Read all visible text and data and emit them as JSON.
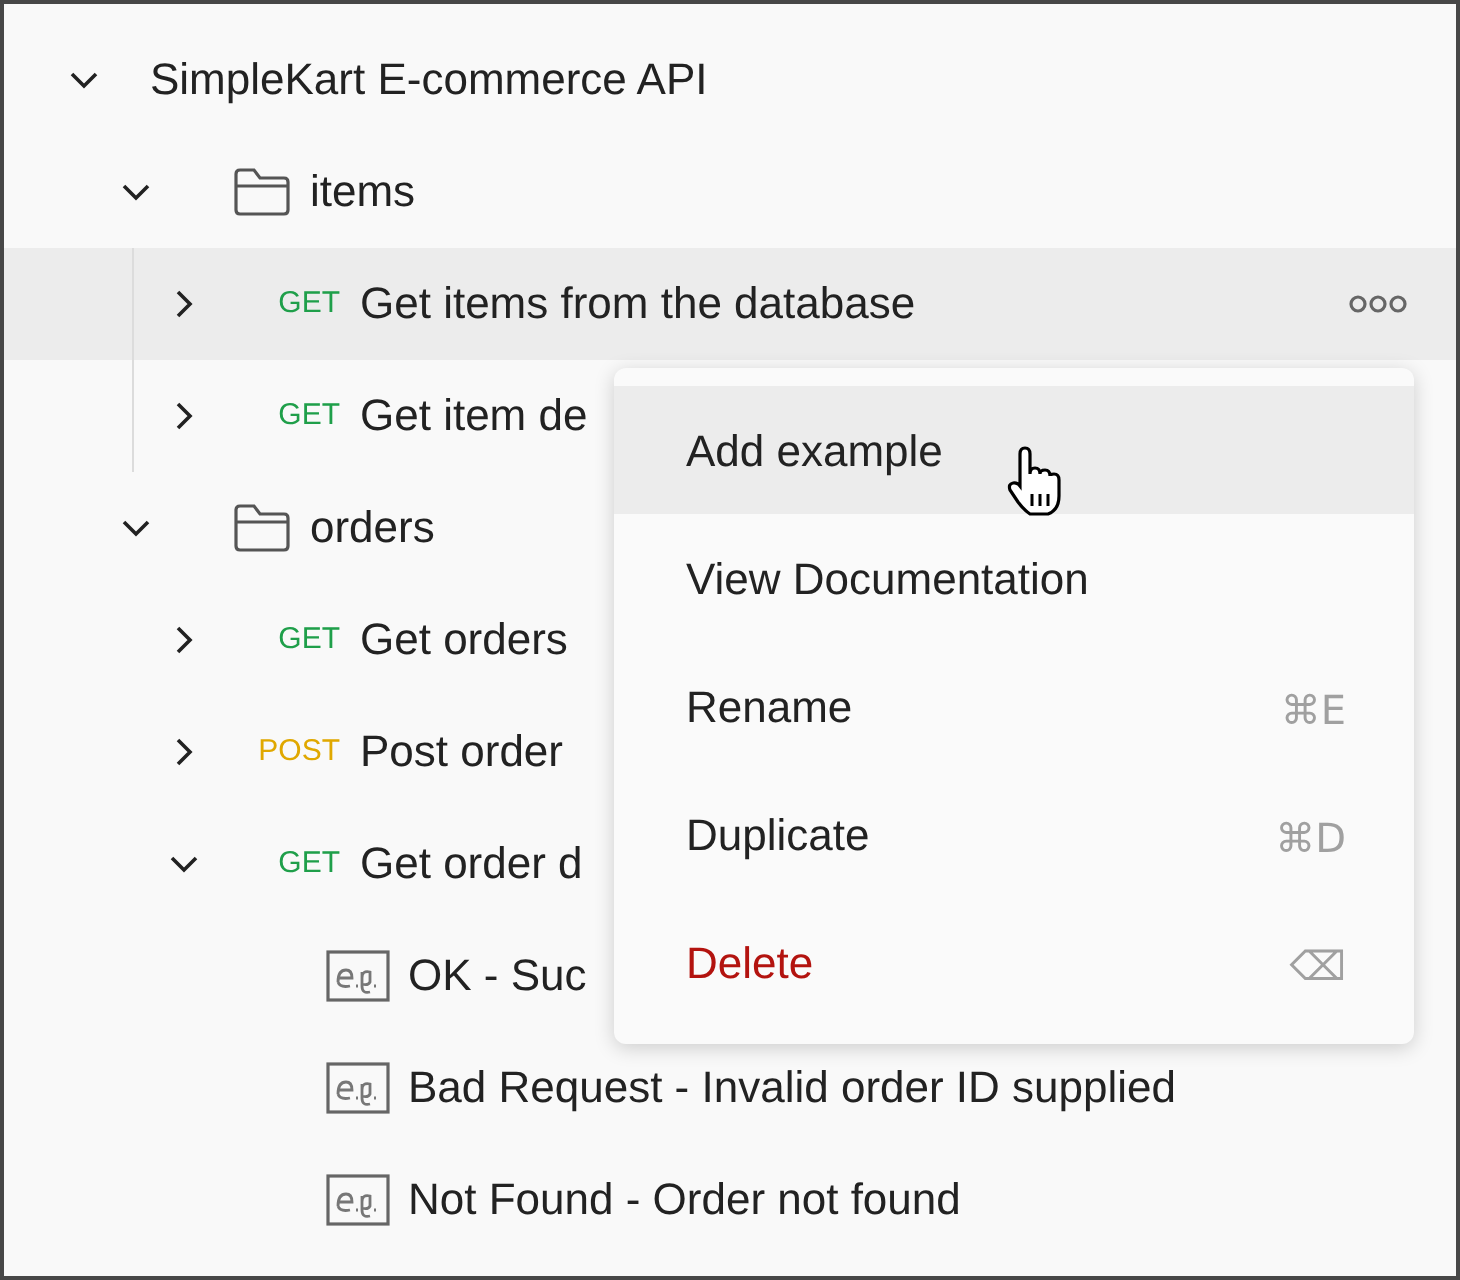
{
  "collection": {
    "name": "SimpleKart E-commerce API",
    "expanded": true,
    "children": [
      {
        "name": "items",
        "expanded": true,
        "children": [
          {
            "method": "GET",
            "name": "Get items from the database",
            "expanded": false,
            "selected": true
          },
          {
            "method": "GET",
            "name": "Get item de",
            "expanded": false,
            "selected": false
          }
        ]
      },
      {
        "name": "orders",
        "expanded": true,
        "children": [
          {
            "method": "GET",
            "name": "Get orders",
            "expanded": false,
            "selected": false
          },
          {
            "method": "POST",
            "name": "Post order",
            "expanded": false,
            "selected": false
          },
          {
            "method": "GET",
            "name": "Get order d",
            "expanded": true,
            "selected": false,
            "children": [
              {
                "name": "OK - Suc"
              },
              {
                "name": "Bad Request - Invalid order ID supplied"
              },
              {
                "name": "Not Found - Order not found"
              }
            ]
          }
        ]
      }
    ]
  },
  "context_menu": {
    "items": [
      {
        "label": "Add example",
        "selected": true,
        "danger": false
      },
      {
        "label": "View Documentation",
        "selected": false,
        "danger": false
      },
      {
        "label": "Rename",
        "shortcut": "⌘E",
        "selected": false,
        "danger": false
      },
      {
        "label": "Duplicate",
        "shortcut": "⌘D",
        "selected": false,
        "danger": false
      },
      {
        "label": "Delete",
        "shortcut": "⌫",
        "selected": false,
        "danger": true
      }
    ]
  }
}
